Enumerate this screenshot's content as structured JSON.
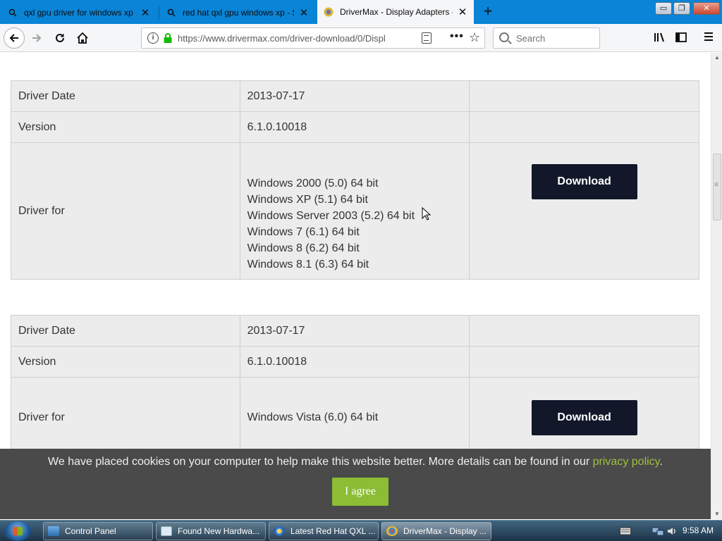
{
  "browser": {
    "tabs": [
      {
        "title": "qxl gpu driver for windows xp - ",
        "active": false
      },
      {
        "title": "red hat qxl gpu windows xp - St",
        "active": false
      },
      {
        "title": "DriverMax - Display Adapters - P",
        "active": true
      }
    ],
    "url": "https://www.drivermax.com/driver-download/0/Displ",
    "search_placeholder": "Search",
    "window_buttons": {
      "minimize": "▭",
      "restore": "❐",
      "close": "✕"
    }
  },
  "drivers": [
    {
      "date_label": "Driver Date",
      "date": "2013-07-17",
      "version_label": "Version",
      "version": "6.1.0.10018",
      "for_label": "Driver for",
      "os": [
        "Windows 2000 (5.0) 64 bit",
        "Windows XP (5.1) 64 bit",
        "Windows Server 2003 (5.2) 64 bit",
        "Windows 7 (6.1) 64 bit",
        "Windows 8 (6.2) 64 bit",
        "Windows 8.1 (6.3) 64 bit"
      ],
      "download_label": "Download"
    },
    {
      "date_label": "Driver Date",
      "date": "2013-07-17",
      "version_label": "Version",
      "version": "6.1.0.10018",
      "for_label": "Driver for",
      "os": [
        "Windows Vista (6.0) 64 bit"
      ],
      "download_label": "Download"
    }
  ],
  "cookie_banner": {
    "text": "We have placed cookies on your computer to help make this website better. More details can be found in our ",
    "link": "privacy policy",
    "after": ".",
    "button": "I agree"
  },
  "taskbar": {
    "items": [
      {
        "label": "Control Panel",
        "active": false
      },
      {
        "label": "Found New Hardwa...",
        "active": false
      },
      {
        "label": "Latest Red Hat QXL ...",
        "active": false
      },
      {
        "label": "DriverMax - Display ...",
        "active": true
      }
    ],
    "clock": "9:58 AM"
  },
  "colors": {
    "tabbar": "#0a84d6",
    "download_button": "#12182a",
    "agree_button": "#8cbd35",
    "privacy_link": "#9bc23c",
    "cookie_bg": "#4a4a4a"
  }
}
